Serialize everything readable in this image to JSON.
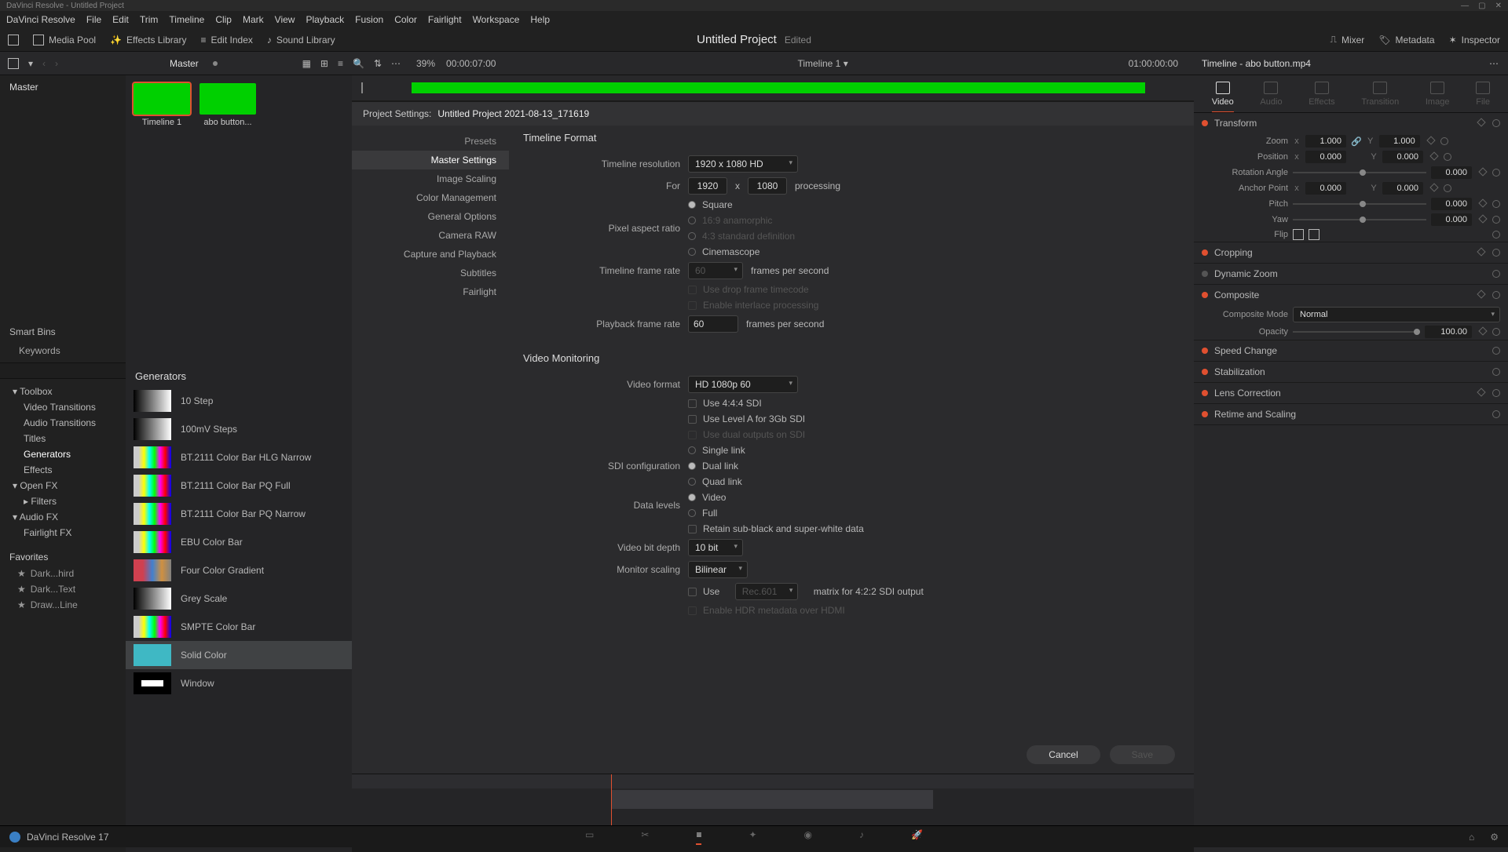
{
  "window": {
    "title": "DaVinci Resolve - Untitled Project"
  },
  "menu": [
    "DaVinci Resolve",
    "File",
    "Edit",
    "Trim",
    "Timeline",
    "Clip",
    "Mark",
    "View",
    "Playback",
    "Fusion",
    "Color",
    "Fairlight",
    "Workspace",
    "Help"
  ],
  "toolbar": {
    "media_pool": "Media Pool",
    "effects_library": "Effects Library",
    "edit_index": "Edit Index",
    "sound_library": "Sound Library",
    "project": "Untitled Project",
    "edited": "Edited",
    "mixer": "Mixer",
    "metadata": "Metadata",
    "inspector": "Inspector"
  },
  "subbar": {
    "master": "Master",
    "zoom": "39%",
    "tc_left": "00:00:07:00",
    "timeline_name": "Timeline 1",
    "tc_right": "01:00:00:00",
    "inspector_title": "Timeline - abo button.mp4"
  },
  "media": {
    "master_hdr": "Master",
    "smart_bins": "Smart Bins",
    "keywords": "Keywords",
    "clip1": "Timeline 1",
    "clip2": "abo button..."
  },
  "toolbox": {
    "header": "Toolbox",
    "video_trans": "Video Transitions",
    "audio_trans": "Audio Transitions",
    "titles": "Titles",
    "generators": "Generators",
    "effects": "Effects",
    "openfx": "Open FX",
    "filters": "Filters",
    "audiofx": "Audio FX",
    "fairlightfx": "Fairlight FX",
    "favorites": "Favorites",
    "fav1": "Dark...hird",
    "fav2": "Dark...Text",
    "fav3": "Draw...Line"
  },
  "generators": {
    "header": "Generators",
    "items": [
      "10 Step",
      "100mV Steps",
      "BT.2111 Color Bar HLG Narrow",
      "BT.2111 Color Bar PQ Full",
      "BT.2111 Color Bar PQ Narrow",
      "EBU Color Bar",
      "Four Color Gradient",
      "Grey Scale",
      "SMPTE Color Bar",
      "Solid Color",
      "Window"
    ]
  },
  "dialog": {
    "title_label": "Project Settings:",
    "title": "Untitled Project 2021-08-13_171619",
    "nav": [
      "Presets",
      "Master Settings",
      "Image Scaling",
      "Color Management",
      "General Options",
      "Camera RAW",
      "Capture and Playback",
      "Subtitles",
      "Fairlight"
    ],
    "timeline_format": "Timeline Format",
    "timeline_resolution_label": "Timeline resolution",
    "timeline_resolution": "1920 x 1080 HD",
    "for": "For",
    "w": "1920",
    "by": "x",
    "h": "1080",
    "processing": "processing",
    "par_label": "Pixel aspect ratio",
    "par_square": "Square",
    "par_169": "16:9 anamorphic",
    "par_43": "4:3 standard definition",
    "par_cine": "Cinemascope",
    "tfr_label": "Timeline frame rate",
    "tfr": "60",
    "fps": "frames per second",
    "drop_tc": "Use drop frame timecode",
    "interlace": "Enable interlace processing",
    "pfr_label": "Playback frame rate",
    "pfr": "60",
    "video_monitoring": "Video Monitoring",
    "vf_label": "Video format",
    "vf": "HD 1080p 60",
    "use444": "Use 4:4:4 SDI",
    "levelA": "Use Level A for 3Gb SDI",
    "dualout": "Use dual outputs on SDI",
    "sdi_label": "SDI configuration",
    "sdi_single": "Single link",
    "sdi_dual": "Dual link",
    "sdi_quad": "Quad link",
    "data_levels_label": "Data levels",
    "dl_video": "Video",
    "dl_full": "Full",
    "retain": "Retain sub-black and super-white data",
    "bitdepth_label": "Video bit depth",
    "bitdepth": "10 bit",
    "monscale_label": "Monitor scaling",
    "monscale": "Bilinear",
    "use_label": "Use",
    "rec": "Rec.601",
    "matrix": "matrix for 4:2:2 SDI output",
    "hdr": "Enable HDR metadata over HDMI",
    "cancel": "Cancel",
    "save": "Save"
  },
  "inspector": {
    "tabs": [
      "Video",
      "Audio",
      "Effects",
      "Transition",
      "Image",
      "File"
    ],
    "transform": "Transform",
    "zoom_label": "Zoom",
    "zoom_x": "1.000",
    "zoom_y": "1.000",
    "position_label": "Position",
    "pos_x": "0.000",
    "pos_y": "0.000",
    "rotation_label": "Rotation Angle",
    "rotation": "0.000",
    "anchor_label": "Anchor Point",
    "anchor_x": "0.000",
    "anchor_y": "0.000",
    "pitch_label": "Pitch",
    "pitch": "0.000",
    "yaw_label": "Yaw",
    "yaw": "0.000",
    "flip_label": "Flip",
    "cropping": "Cropping",
    "dynzoom": "Dynamic Zoom",
    "composite": "Composite",
    "compmode_label": "Composite Mode",
    "compmode": "Normal",
    "opacity_label": "Opacity",
    "opacity": "100.00",
    "speed": "Speed Change",
    "stab": "Stabilization",
    "lens": "Lens Correction",
    "retime": "Retime and Scaling"
  },
  "footer": {
    "brand": "DaVinci Resolve 17"
  }
}
